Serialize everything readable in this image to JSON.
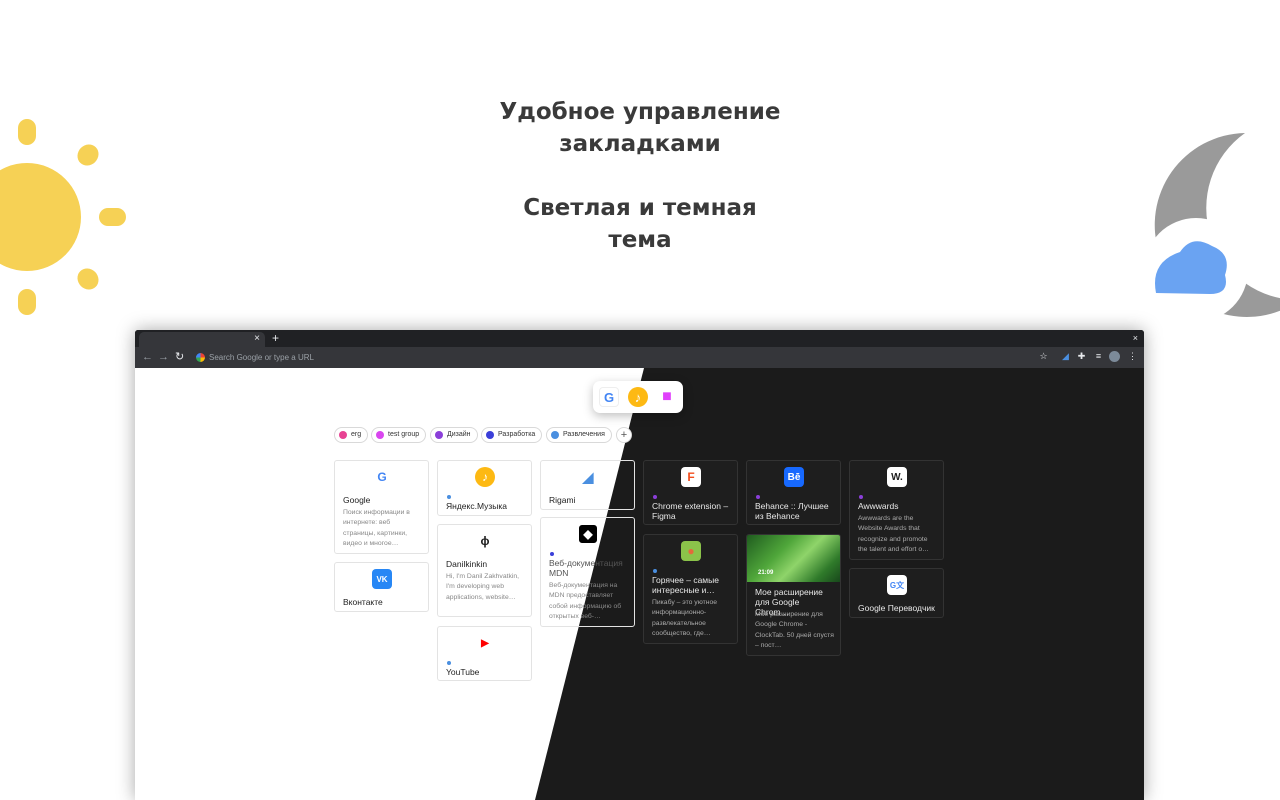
{
  "headline": {
    "line1": "Удобное управление",
    "line2": "закладками",
    "line3": "Светлая и темная",
    "line4": "тема"
  },
  "browser": {
    "tab_close": "×",
    "new_tab": "+",
    "window_close": "×",
    "back": "←",
    "forward": "→",
    "reload": "↻",
    "omnibox_placeholder": "Search Google or type a URL"
  },
  "dock": [
    {
      "icon": "google-icon",
      "glyph": "G",
      "color": "#4285f4",
      "bg": "#ffffff"
    },
    {
      "icon": "yandex-music-icon",
      "glyph": "♪",
      "color": "#ffffff",
      "bg": "#fdb913"
    },
    {
      "icon": "folder-icon",
      "glyph": "▬",
      "color": "#ffffff",
      "bg": "#e040fb"
    }
  ],
  "groups": [
    {
      "label": "erg",
      "color": "#e84393"
    },
    {
      "label": "test group",
      "color": "#d946ef"
    },
    {
      "label": "Дизайн",
      "color": "#8b3fd9"
    },
    {
      "label": "Разработка",
      "color": "#3b3fd9"
    },
    {
      "label": "Развлечения",
      "color": "#4a8fe0"
    }
  ],
  "add_group": "+",
  "cards": {
    "google": {
      "title": "Google",
      "desc": "Поиск информации в интернете: веб страницы, картинки, видео и многое…",
      "glyph": "G"
    },
    "vk": {
      "title": "Вконтакте",
      "glyph": "VK"
    },
    "yandex": {
      "title": "Яндекс.Музыка",
      "glyph": "♪"
    },
    "danil": {
      "title": "Danilkinkin",
      "desc": "Hi, I'm Danil Zakhvatkin, I'm developing web applications, website…",
      "glyph": "ɸ"
    },
    "youtube": {
      "title": "YouTube",
      "glyph": "▶"
    },
    "rigami": {
      "title": "Rigami",
      "glyph": "◢"
    },
    "mdn": {
      "title": "Веб-документация MDN",
      "desc": "Веб-документация на MDN предоставляет собой информацию об открытых веб-…",
      "glyph": "◆"
    },
    "figma": {
      "title": "Chrome extension – Figma",
      "glyph": "F"
    },
    "pikabu": {
      "title": "Горячее – самые интересные и…",
      "desc": "Пикабу – это уютное информационно-развлекательное сообщество, где…",
      "glyph": "●"
    },
    "behance": {
      "title": "Behance :: Лучшее из Behance",
      "glyph": "Bē"
    },
    "clocktab": {
      "title": "Мое расширение для Google Chrom…",
      "desc": "Мое расширение для Google Chrome - ClockTab. 50 дней спустя – пост…",
      "time": "21:09"
    },
    "awwwards": {
      "title": "Awwwards",
      "desc": "Awwwards are the Website Awards that recognize and promote the talent and effort o…",
      "glyph": "W."
    },
    "translate": {
      "title": "Google Переводчик",
      "glyph": "G文"
    }
  },
  "colors": {
    "sun": "#f6d155",
    "moon": "#9a9a9a",
    "cloud": "#6aa3f2",
    "dark_page": "#1b1b1b"
  }
}
